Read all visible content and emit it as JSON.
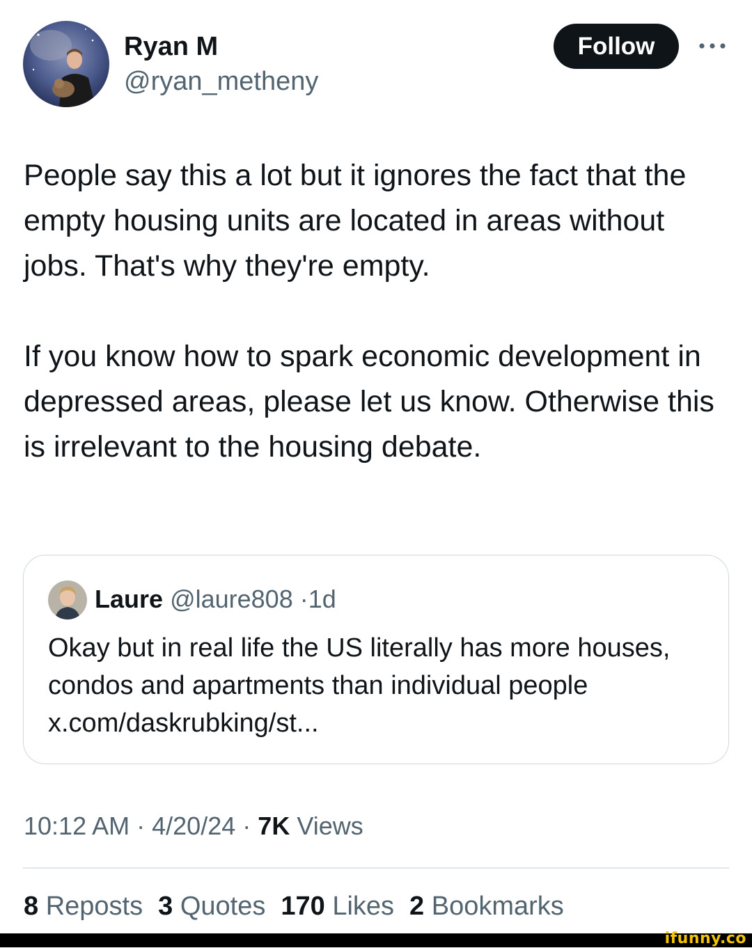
{
  "author": {
    "name": "Ryan M",
    "handle": "@ryan_metheny"
  },
  "header": {
    "follow_label": "Follow",
    "more_icon": "more-horizontal-icon"
  },
  "tweet": {
    "paragraphs": [
      "People say this a lot but it ignores the fact that the empty housing units are located in areas without jobs. That's why they're empty.",
      "If you know how to spark economic development in depressed areas, please let us know. Otherwise this is irrelevant to the housing debate."
    ]
  },
  "quote": {
    "name": "Laure",
    "handle": "@laure808",
    "separator": "·",
    "age": "1d",
    "text": "Okay but in real life the US literally has more houses, condos and apartments than individual people x.com/daskrubking/st..."
  },
  "meta": {
    "time": "10:12 AM",
    "separator": "·",
    "date": "4/20/24",
    "views_count": "7K",
    "views_label": "Views"
  },
  "stats": {
    "reposts_count": "8",
    "reposts_label": "Reposts",
    "quotes_count": "3",
    "quotes_label": "Quotes",
    "likes_count": "170",
    "likes_label": "Likes",
    "bookmarks_count": "2",
    "bookmarks_label": "Bookmarks"
  },
  "watermark": {
    "text": "ifunny.co"
  },
  "colors": {
    "text_primary": "#0f1419",
    "text_secondary": "#536471",
    "border": "#cfd9de",
    "follow_bg": "#0f1419",
    "watermark": "#f5c400"
  }
}
